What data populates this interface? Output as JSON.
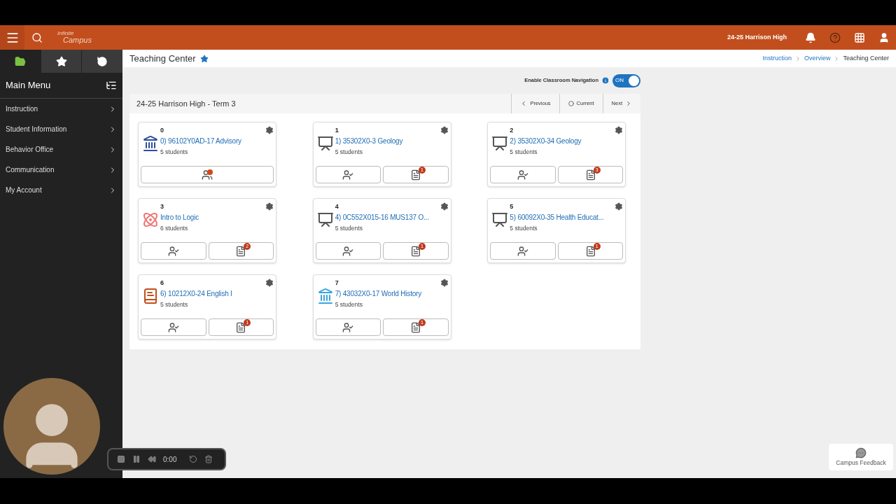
{
  "header": {
    "logo": {
      "line1": "Infinite",
      "line2": "Campus"
    },
    "school": "24-25 Harrison High"
  },
  "sidebar": {
    "tabs": [
      {
        "kind": "folder",
        "selected": true
      },
      {
        "kind": "star",
        "selected": false
      },
      {
        "kind": "history",
        "selected": false
      }
    ],
    "title": "Main Menu",
    "items": [
      {
        "label": "Instruction"
      },
      {
        "label": "Student Information"
      },
      {
        "label": "Behavior Office"
      },
      {
        "label": "Communication"
      },
      {
        "label": "My Account"
      }
    ]
  },
  "page": {
    "title": "Teaching Center",
    "favorite": true,
    "breadcrumbs": [
      {
        "label": "Instruction",
        "link": true
      },
      {
        "label": "Overview",
        "link": true
      },
      {
        "label": "Teaching Center",
        "link": false
      }
    ]
  },
  "toggle": {
    "label": "Enable Classroom Navigation",
    "on": true,
    "text": "ON"
  },
  "term": "24-25 Harrison High - Term 3",
  "nav": [
    {
      "kind": "prev",
      "label": "Previous"
    },
    {
      "kind": "current",
      "label": "Current"
    },
    {
      "kind": "next",
      "label": "Next"
    }
  ],
  "cards": [
    {
      "number": "0",
      "title": "0) 96102Y0AD-17 Advisory",
      "students": "5 students",
      "kind": "bank-dark",
      "actions": [
        {
          "kind": "roster-alert"
        }
      ]
    },
    {
      "number": "1",
      "title": "1) 35302X0-3 Geology",
      "students": "5 students",
      "kind": "board",
      "actions": [
        {
          "kind": "attendance"
        },
        {
          "kind": "grades",
          "count": "1"
        }
      ]
    },
    {
      "number": "2",
      "title": "2) 35302X0-34 Geology",
      "students": "5 students",
      "kind": "board",
      "actions": [
        {
          "kind": "attendance"
        },
        {
          "kind": "grades",
          "count": "3"
        }
      ]
    },
    {
      "number": "3",
      "title": "Intro to Logic",
      "students": "6 students",
      "kind": "atom",
      "actions": [
        {
          "kind": "attendance"
        },
        {
          "kind": "grades",
          "count": "2"
        }
      ]
    },
    {
      "number": "4",
      "title": "4) 0C552X015-16 MUS137 O...",
      "students": "5 students",
      "kind": "board",
      "actions": [
        {
          "kind": "attendance"
        },
        {
          "kind": "grades",
          "count": "1"
        }
      ]
    },
    {
      "number": "5",
      "title": "5) 60092X0-35 Health Educat...",
      "students": "5 students",
      "kind": "board",
      "actions": [
        {
          "kind": "attendance"
        },
        {
          "kind": "grades",
          "count": "1"
        }
      ]
    },
    {
      "number": "6",
      "title": "6) 10212X0-24 English I",
      "students": "5 students",
      "kind": "book",
      "actions": [
        {
          "kind": "attendance"
        },
        {
          "kind": "grades",
          "count": "1"
        }
      ]
    },
    {
      "number": "7",
      "title": "7) 43032X0-17 World History",
      "students": "5 students",
      "kind": "bank-light",
      "actions": [
        {
          "kind": "attendance"
        },
        {
          "kind": "grades",
          "count": "1"
        }
      ]
    }
  ],
  "recorder": {
    "time": "0:00"
  },
  "feedback": {
    "label": "Campus Feedback"
  }
}
